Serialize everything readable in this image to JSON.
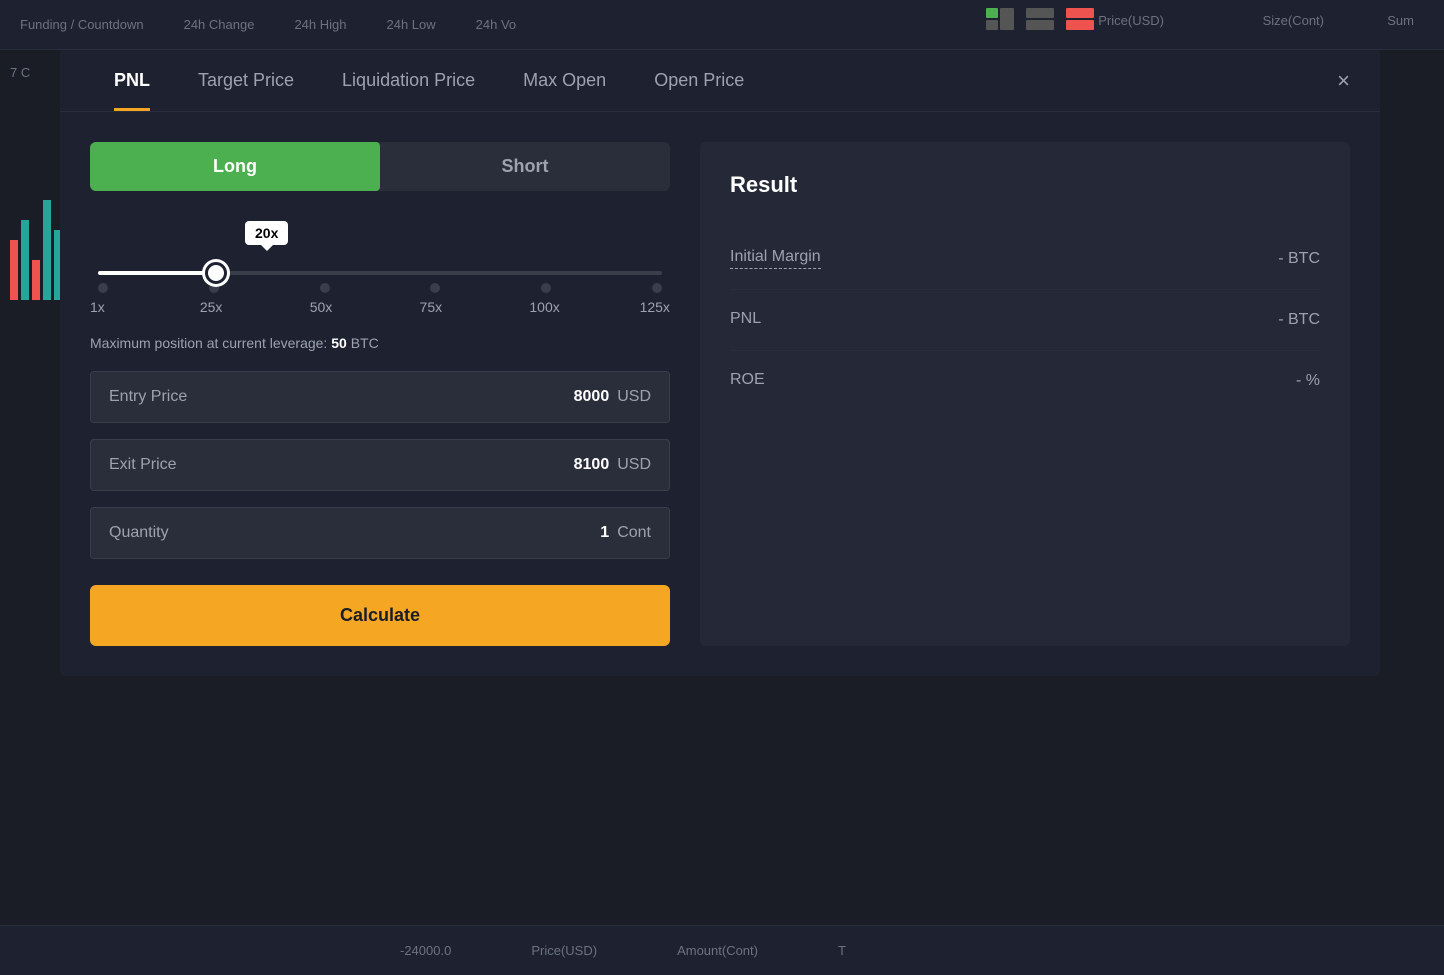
{
  "background": {
    "header_items": [
      "Funding / Countdown",
      "24h Change",
      "24h High",
      "24h Low",
      "24h Vo"
    ],
    "price_col": "Price(USD)",
    "size_col": "Size(Cont)",
    "sum_col": "Sum",
    "bottom_items": [
      "-24000.0",
      "Price(USD)",
      "Amount(Cont)",
      "T"
    ],
    "num_label": "7 C"
  },
  "tabs": {
    "active": "PNL",
    "items": [
      "PNL",
      "Target Price",
      "Liquidation Price",
      "Max Open",
      "Open Price"
    ]
  },
  "close_btn": "×",
  "toggle": {
    "long_label": "Long",
    "short_label": "Short",
    "active": "long"
  },
  "leverage": {
    "badge": "20x",
    "marks": [
      "1x",
      "25x",
      "50x",
      "75x",
      "100x",
      "125x"
    ],
    "max_position_prefix": "Maximum position at current leverage: ",
    "max_position_value": "50",
    "max_position_unit": "BTC"
  },
  "inputs": {
    "entry_price": {
      "label": "Entry Price",
      "value": "8000",
      "unit": "USD"
    },
    "exit_price": {
      "label": "Exit Price",
      "value": "8100",
      "unit": "USD"
    },
    "quantity": {
      "label": "Quantity",
      "value": "1",
      "unit": "Cont"
    }
  },
  "calculate_btn": "Calculate",
  "result": {
    "title": "Result",
    "rows": [
      {
        "label": "Initial Margin",
        "value": "-",
        "unit": "BTC",
        "dashed": true
      },
      {
        "label": "PNL",
        "value": "-",
        "unit": "BTC",
        "dashed": false
      },
      {
        "label": "ROE",
        "value": "-",
        "unit": "%",
        "dashed": false
      }
    ]
  },
  "colors": {
    "long_green": "#4caf50",
    "calculate_yellow": "#f5a623",
    "active_tab_underline": "#f5a623"
  }
}
